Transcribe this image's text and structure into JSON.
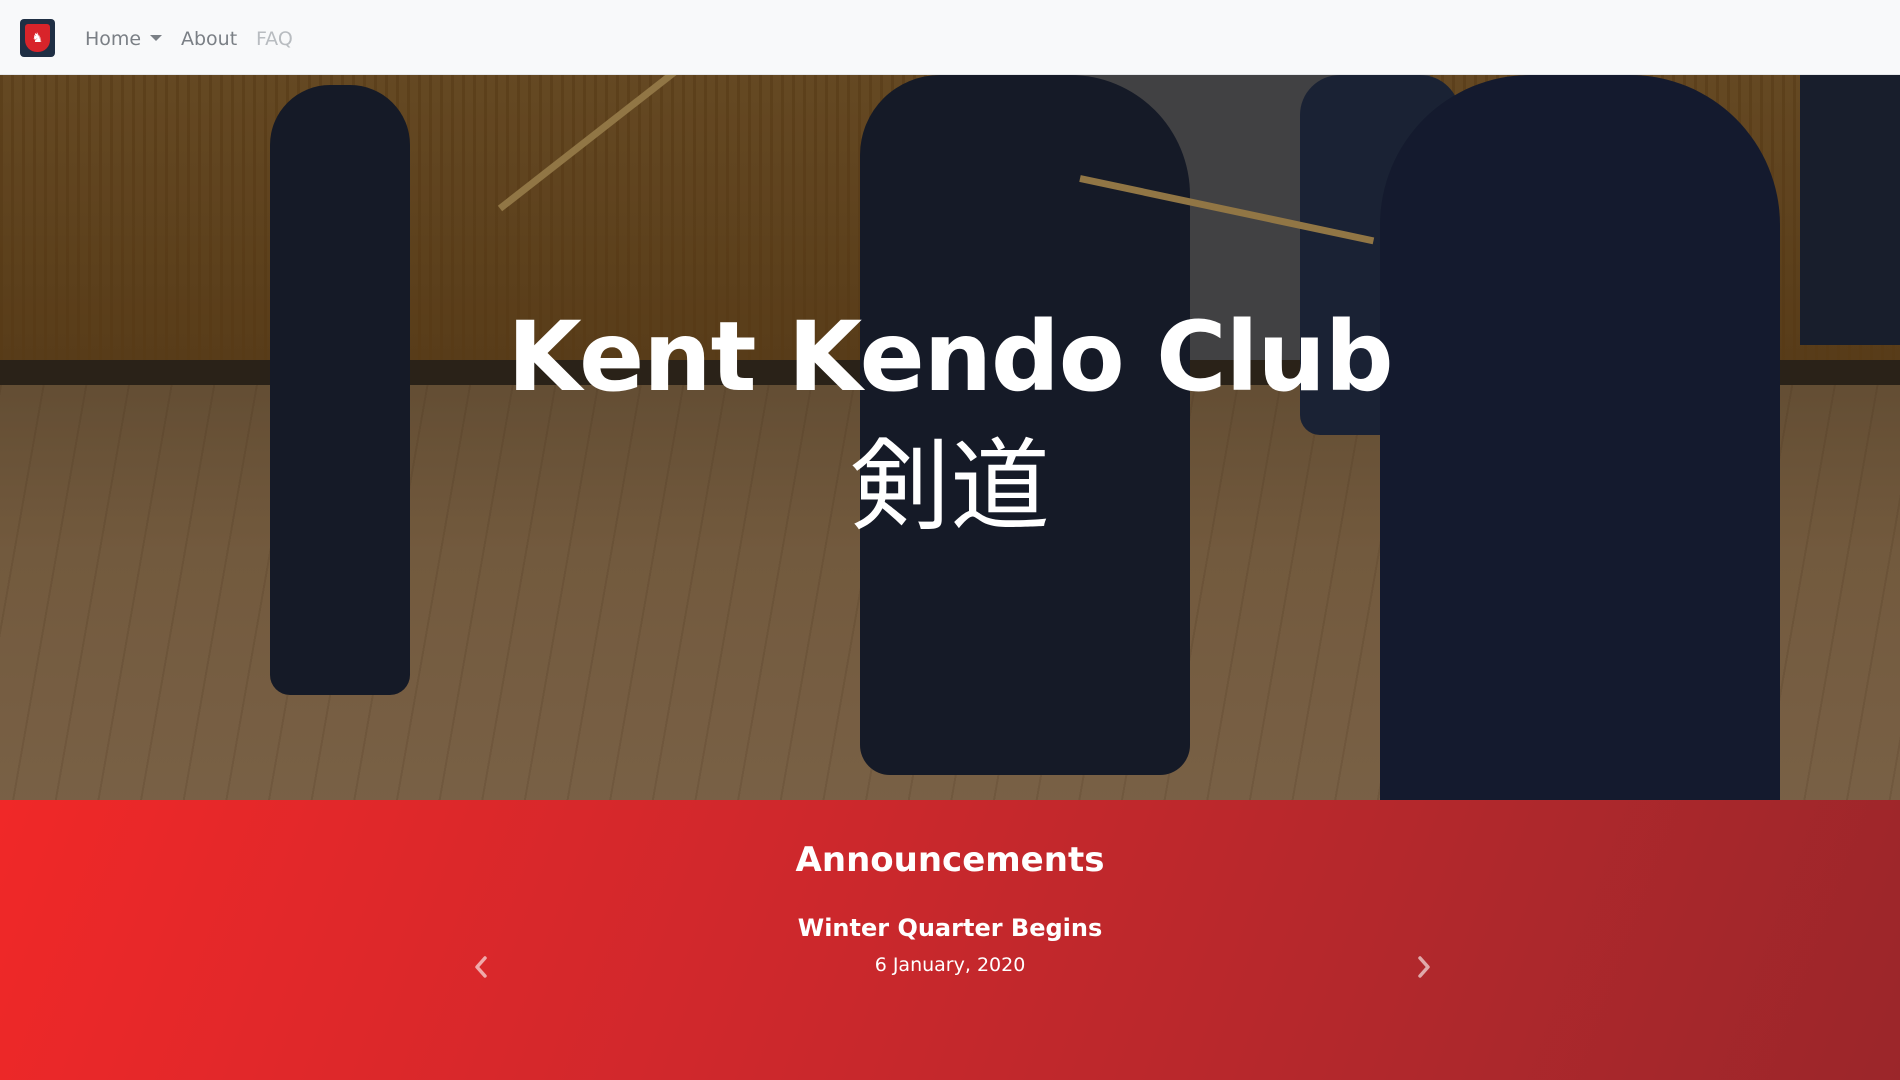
{
  "navbar": {
    "logo_name": "kent-crest-logo",
    "items": [
      {
        "label": "Home",
        "has_dropdown": true
      },
      {
        "label": "About"
      },
      {
        "label": "FAQ",
        "disabled": true
      }
    ]
  },
  "hero": {
    "title": "Kent Kendo Club",
    "subtitle": "剣道"
  },
  "announcements": {
    "heading": "Announcements",
    "current": {
      "title": "Winter Quarter Begins",
      "date": "6 January, 2020"
    },
    "prev_icon": "chevron-left-icon",
    "next_icon": "chevron-right-icon"
  },
  "colors": {
    "navbar_bg": "#f8f9fa",
    "accent_red": "#e32a2a"
  }
}
